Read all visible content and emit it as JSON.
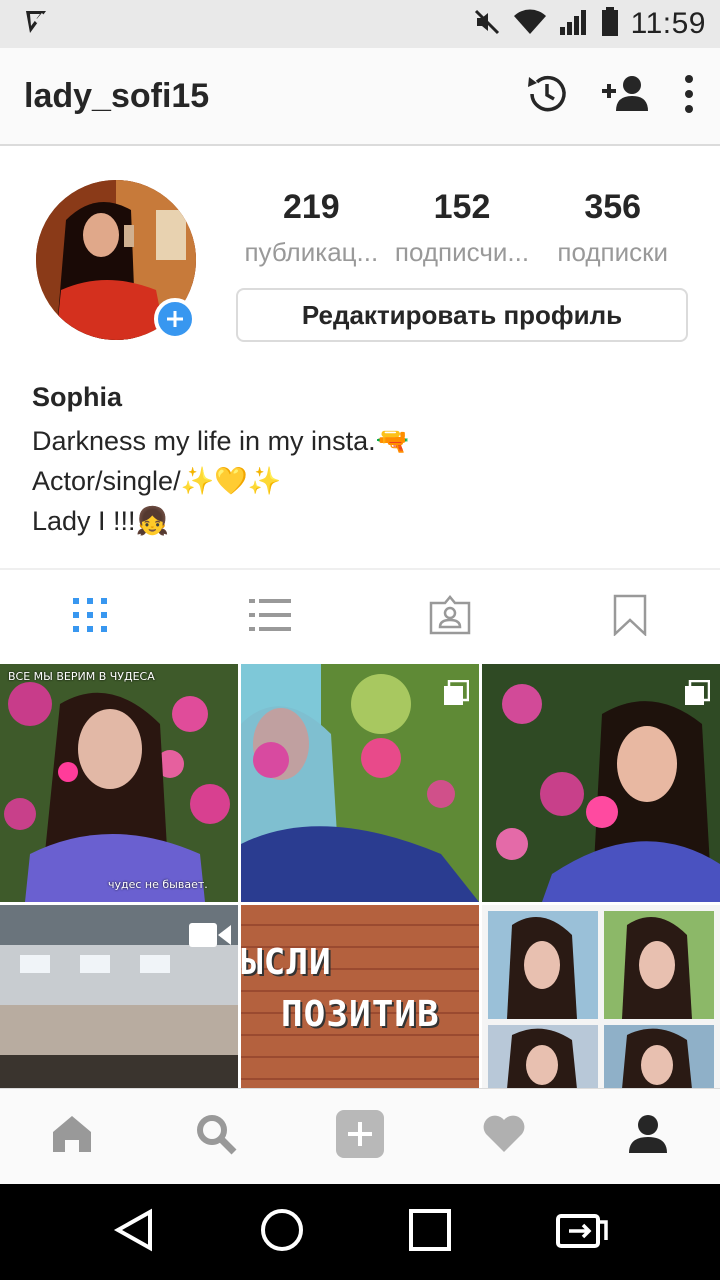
{
  "status": {
    "time": "11:59"
  },
  "header": {
    "username": "lady_sofi15"
  },
  "profile": {
    "stats": [
      {
        "value": "219",
        "label": "публикац..."
      },
      {
        "value": "152",
        "label": "подписчи..."
      },
      {
        "value": "356",
        "label": "подписки"
      }
    ],
    "edit_button": "Редактировать профиль",
    "name": "Sophia",
    "bio": [
      "Darkness my life in my insta.🔫",
      "Actor/single/✨💛✨",
      "Lady I !!!👧"
    ]
  },
  "posts": [
    {
      "top_caption": "ВСЕ МЫ ВЕРИМ В ЧУДЕСА",
      "bottom_caption": "чудес не бывает."
    },
    {
      "badge": "multiple"
    },
    {
      "badge": "multiple"
    },
    {
      "badge": "video"
    },
    {
      "text": [
        "ЫСЛИ",
        "ПОЗИТИВ"
      ]
    },
    {}
  ],
  "colors": {
    "accent": "#3897f0",
    "text": "#262626",
    "muted": "#999999"
  }
}
